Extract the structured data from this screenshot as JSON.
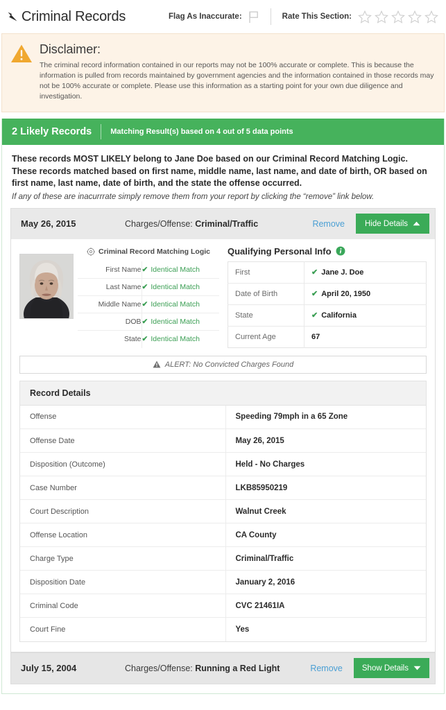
{
  "header": {
    "back_icon": "back-arrow-icon",
    "title": "Criminal Records",
    "flag_label": "Flag As Inaccurate:",
    "flag_icon": "flag-icon",
    "rate_label": "Rate This Section:",
    "star_count": 5,
    "stars_filled": 0
  },
  "disclaimer": {
    "icon": "warning-triangle-icon",
    "title": "Disclaimer:",
    "text": "The criminal record information contained in our reports may not be 100% accurate or complete. This is because the information is pulled from records maintained by government agencies and the information contained in those records may not be 100% accurate or complete. Please use this information as a starting point for your own due diligence and investigation."
  },
  "results": {
    "banner_count": "2 Likely Records",
    "banner_sub": "Matching Result(s) based on 4 out of 5 data points",
    "intro_bold": "These records MOST LIKELY belong to Jane Doe based on our Criminal Record Matching Logic. These records matched based on first name, middle name, last name, and date of birth, OR based on first name, last name, date of birth, and the state the offense occurred.",
    "intro_italic": "If any of these are inacurrrate simply remove them from your report by clicking the “remove” link below."
  },
  "record1": {
    "date": "May 26, 2015",
    "charge_label": "Charges/Offense:",
    "charge_value": "Criminal/Traffic",
    "remove_label": "Remove",
    "details_button": "Hide Details",
    "details_caret": "caret-up-icon",
    "photo_alt": "mugshot-photo",
    "logic": {
      "icon": "gear-icon",
      "title": "Criminal Record Matching Logic",
      "rows": [
        {
          "key": "First Name",
          "value": "Identical Match"
        },
        {
          "key": "Last Name",
          "value": "Identical Match"
        },
        {
          "key": "Middle Name",
          "value": "Identical Match"
        },
        {
          "key": "DOB",
          "value": "Identical Match"
        },
        {
          "key": "State",
          "value": "Identical Match"
        }
      ]
    },
    "qpi": {
      "title": "Qualifying Personal Info",
      "info_icon": "info-icon",
      "rows": [
        {
          "key": "First",
          "value": "Jane J. Doe",
          "check": true
        },
        {
          "key": "Date of Birth",
          "value": "April 20, 1950",
          "check": true
        },
        {
          "key": "State",
          "value": "California",
          "check": true
        },
        {
          "key": "Current Age",
          "value": "67",
          "check": false
        }
      ]
    },
    "alert": {
      "icon": "alert-triangle-icon",
      "text": "ALERT: No Convicted Charges Found"
    },
    "details": {
      "title": "Record Details",
      "rows": [
        {
          "key": "Offense",
          "value": "Speeding 79mph in a 65 Zone"
        },
        {
          "key": "Offense Date",
          "value": "May 26, 2015"
        },
        {
          "key": "Disposition (Outcome)",
          "value": "Held - No Charges"
        },
        {
          "key": "Case Number",
          "value": "LKB85950219"
        },
        {
          "key": "Court Description",
          "value": "Walnut Creek"
        },
        {
          "key": "Offense Location",
          "value": "CA County"
        },
        {
          "key": "Charge Type",
          "value": "Criminal/Traffic"
        },
        {
          "key": "Disposition Date",
          "value": "January 2, 2016"
        },
        {
          "key": "Criminal Code",
          "value": "CVC 21461IA"
        },
        {
          "key": "Court Fine",
          "value": "Yes"
        }
      ]
    }
  },
  "record2": {
    "date": "July 15, 2004",
    "charge_label": "Charges/Offense:",
    "charge_value": "Running a Red Light",
    "remove_label": "Remove",
    "details_button": "Show Details",
    "details_caret": "caret-down-icon"
  },
  "colors": {
    "green_banner": "#46b25c",
    "green_button": "#3bab58",
    "green_check": "#3a9e53",
    "link_blue": "#4a9fd4",
    "warning_orange": "#f0a830",
    "disclaimer_bg": "#fdf3e7"
  }
}
